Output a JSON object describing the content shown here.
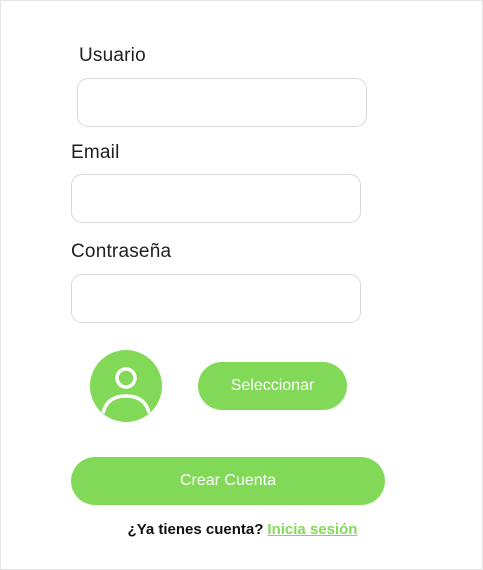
{
  "form": {
    "username": {
      "label": "Usuario",
      "value": "",
      "placeholder": ""
    },
    "email": {
      "label": "Email",
      "value": "",
      "placeholder": ""
    },
    "password": {
      "label": "Contraseña",
      "value": "",
      "placeholder": ""
    },
    "avatar_icon": "user-icon",
    "select_button_label": "Seleccionar",
    "submit_button_label": "Crear Cuenta"
  },
  "footer": {
    "prompt_text": "¿Ya tienes cuenta?",
    "login_link_text": "Inicia sesión"
  },
  "colors": {
    "accent": "#82d957",
    "border": "#d9d9d9",
    "text": "#1f1f1f"
  }
}
